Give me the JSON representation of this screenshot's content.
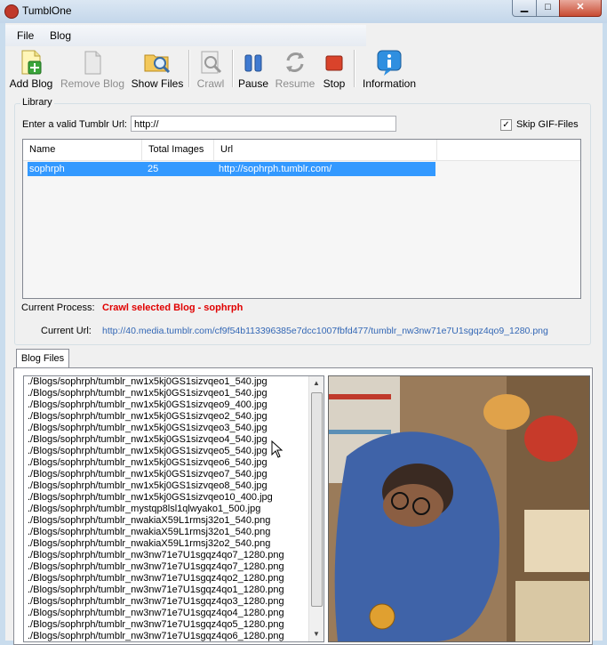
{
  "window": {
    "title": "TumblOne"
  },
  "menu": {
    "file": "File",
    "blog": "Blog"
  },
  "toolbar": {
    "add_blog": "Add Blog",
    "remove_blog": "Remove Blog",
    "show_files": "Show Files",
    "crawl": "Crawl",
    "pause": "Pause",
    "resume": "Resume",
    "stop": "Stop",
    "information": "Information"
  },
  "library": {
    "group_title": "Library",
    "url_label": "Enter a valid Tumblr Url:",
    "url_value": "http://",
    "skip_gif_label": "Skip GIF-Files",
    "skip_gif_checked": "✓",
    "columns": [
      "Name",
      "Total Images",
      "Url"
    ],
    "rows": [
      {
        "name": "sophrph",
        "total": "25",
        "url": "http://sophrph.tumblr.com/"
      }
    ],
    "current_process_label": "Current Process:",
    "current_process_value": "Crawl selected Blog - sophrph",
    "current_url_label": "Current Url:",
    "current_url_value": "http://40.media.tumblr.com/cf9f54b113396385e7dcc1007fbfd477/tumblr_nw3nw71e7U1sgqz4qo9_1280.png"
  },
  "blog_files": {
    "tab_label": "Blog Files",
    "files": [
      "./Blogs/sophrph/tumblr_nw1x5kj0GS1sizvqeo1_540.jpg",
      "./Blogs/sophrph/tumblr_nw1x5kj0GS1sizvqeo1_540.jpg",
      "./Blogs/sophrph/tumblr_nw1x5kj0GS1sizvqeo9_400.jpg",
      "./Blogs/sophrph/tumblr_nw1x5kj0GS1sizvqeo2_540.jpg",
      "./Blogs/sophrph/tumblr_nw1x5kj0GS1sizvqeo3_540.jpg",
      "./Blogs/sophrph/tumblr_nw1x5kj0GS1sizvqeo4_540.jpg",
      "./Blogs/sophrph/tumblr_nw1x5kj0GS1sizvqeo5_540.jpg",
      "./Blogs/sophrph/tumblr_nw1x5kj0GS1sizvqeo6_540.jpg",
      "./Blogs/sophrph/tumblr_nw1x5kj0GS1sizvqeo7_540.jpg",
      "./Blogs/sophrph/tumblr_nw1x5kj0GS1sizvqeo8_540.jpg",
      "./Blogs/sophrph/tumblr_nw1x5kj0GS1sizvqeo10_400.jpg",
      "./Blogs/sophrph/tumblr_mystqp8lsl1qlwyako1_500.jpg",
      "./Blogs/sophrph/tumblr_nwakiaX59L1rmsj32o1_540.png",
      "./Blogs/sophrph/tumblr_nwakiaX59L1rmsj32o1_540.png",
      "./Blogs/sophrph/tumblr_nwakiaX59L1rmsj32o2_540.png",
      "./Blogs/sophrph/tumblr_nw3nw71e7U1sgqz4qo7_1280.png",
      "./Blogs/sophrph/tumblr_nw3nw71e7U1sgqz4qo7_1280.png",
      "./Blogs/sophrph/tumblr_nw3nw71e7U1sgqz4qo2_1280.png",
      "./Blogs/sophrph/tumblr_nw3nw71e7U1sgqz4qo1_1280.png",
      "./Blogs/sophrph/tumblr_nw3nw71e7U1sgqz4qo3_1280.png",
      "./Blogs/sophrph/tumblr_nw3nw71e7U1sgqz4qo4_1280.png",
      "./Blogs/sophrph/tumblr_nw3nw71e7U1sgqz4qo5_1280.png",
      "./Blogs/sophrph/tumblr_nw3nw71e7U1sgqz4qo6_1280.png"
    ]
  },
  "icons": {
    "add_blog": "add-document-icon",
    "remove_blog": "remove-document-icon",
    "show_files": "folder-search-icon",
    "crawl": "crawl-icon",
    "pause": "pause-icon",
    "resume": "resume-icon",
    "stop": "stop-icon",
    "information": "info-icon"
  },
  "colors": {
    "selection": "#3399ff",
    "process_text": "#e00000",
    "url_text": "#3367b5"
  }
}
